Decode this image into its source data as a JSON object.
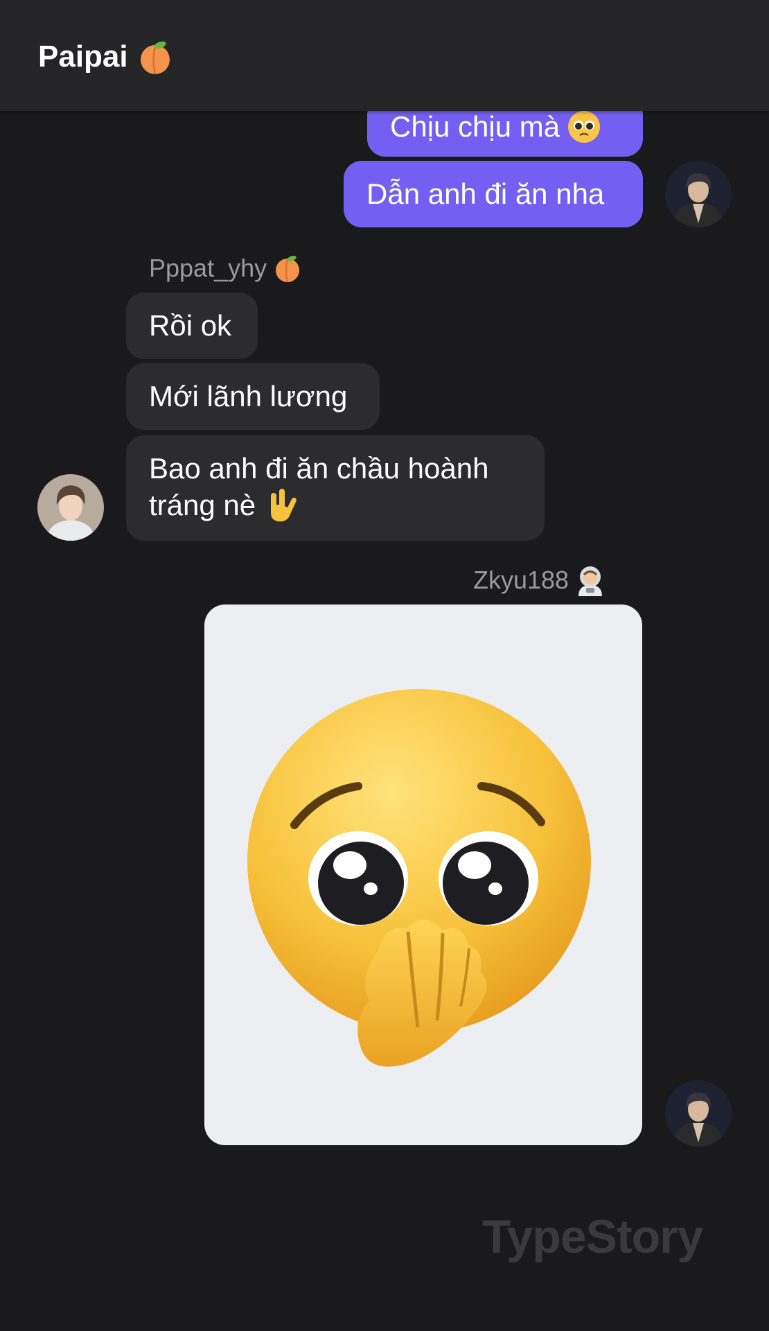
{
  "header": {
    "title": "Paipai",
    "title_icon": "peach-icon"
  },
  "messages": {
    "out1": "Chịu chịu mà",
    "out1_icon": "pleading-face-icon",
    "out2": "Dẫn anh đi ăn nha",
    "sender_pppat": "Pppat_yhy",
    "sender_pppat_icon": "peach-icon",
    "in1": "Rồi ok",
    "in2": "Mới lãnh lương",
    "in3_line1": "Bao anh đi ăn chầu hoành",
    "in3_line2": "tráng nè",
    "in3_icon": "love-you-gesture-icon",
    "sender_zkyu": "Zkyu188",
    "sender_zkyu_icon": "astronaut-icon",
    "image_icon": "pleading-face-with-hand-icon"
  },
  "watermark": "TypeStory",
  "colors": {
    "background": "#1a1a1c",
    "header": "#252527",
    "outgoing_bubble": "#7360f2",
    "incoming_bubble": "#2c2c2e",
    "sender_text": "#9a9a9e"
  }
}
